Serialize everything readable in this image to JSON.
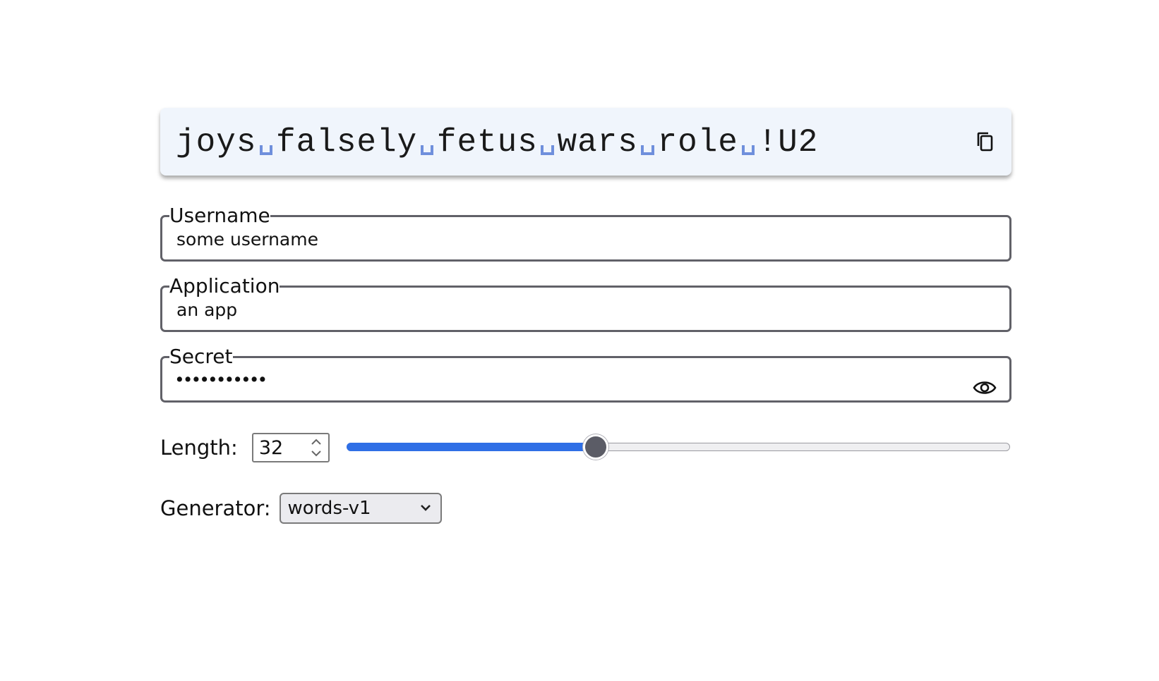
{
  "password": {
    "words": [
      "joys",
      "falsely",
      "fetus",
      "wars",
      "role",
      "!U2"
    ],
    "copy_icon": "copy-icon"
  },
  "fields": {
    "username": {
      "label": "Username",
      "value": "some username"
    },
    "application": {
      "label": "Application",
      "value": "an app"
    },
    "secret": {
      "label": "Secret",
      "masked_value": "•••••••••••",
      "toggle_icon": "eye-icon"
    }
  },
  "length": {
    "label": "Length:",
    "value": "32",
    "slider_fraction": 0.376
  },
  "generator": {
    "label": "Generator:",
    "selected": "words-v1"
  },
  "colors": {
    "accent": "#2f6fe6",
    "space_marker": "#6f8fdc",
    "password_bg": "#f0f5fc"
  }
}
